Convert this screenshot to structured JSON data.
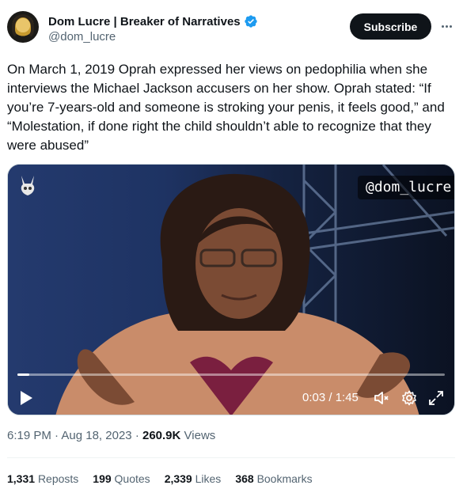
{
  "author": {
    "display_name": "Dom Lucre | Breaker of Narratives",
    "handle": "@dom_lucre",
    "verified": true
  },
  "actions": {
    "subscribe_label": "Subscribe",
    "more_icon": "more-horizontal-icon"
  },
  "tweet": {
    "text": "On March 1, 2019 Oprah expressed her views on pedophilia when she interviews the Michael Jackson accusers on her show. Oprah stated: “If you’re 7-years-old and someone is stroking your penis, it feels good,” and “Molestation, if done right the child shouldn’t able to recognize that they were abused”"
  },
  "video": {
    "watermark_handle": "@dom_lucre",
    "current_time": "0:03",
    "duration": "1:45",
    "time_display": "0:03 / 1:45",
    "progress_fraction": 0.028,
    "icons": [
      "play-icon",
      "mute-icon",
      "settings-icon",
      "fullscreen-icon"
    ]
  },
  "meta": {
    "time": "6:19 PM",
    "date": "Aug 18, 2023",
    "views_count": "260.9K",
    "views_label": "Views"
  },
  "stats": {
    "reposts_count": "1,331",
    "reposts_label": "Reposts",
    "quotes_count": "199",
    "quotes_label": "Quotes",
    "likes_count": "2,339",
    "likes_label": "Likes",
    "bookmarks_count": "368",
    "bookmarks_label": "Bookmarks"
  },
  "colors": {
    "accent_blue": "#1d9bf0",
    "text_primary": "#0f1419",
    "text_secondary": "#536471",
    "button_dark": "#0f1419"
  }
}
